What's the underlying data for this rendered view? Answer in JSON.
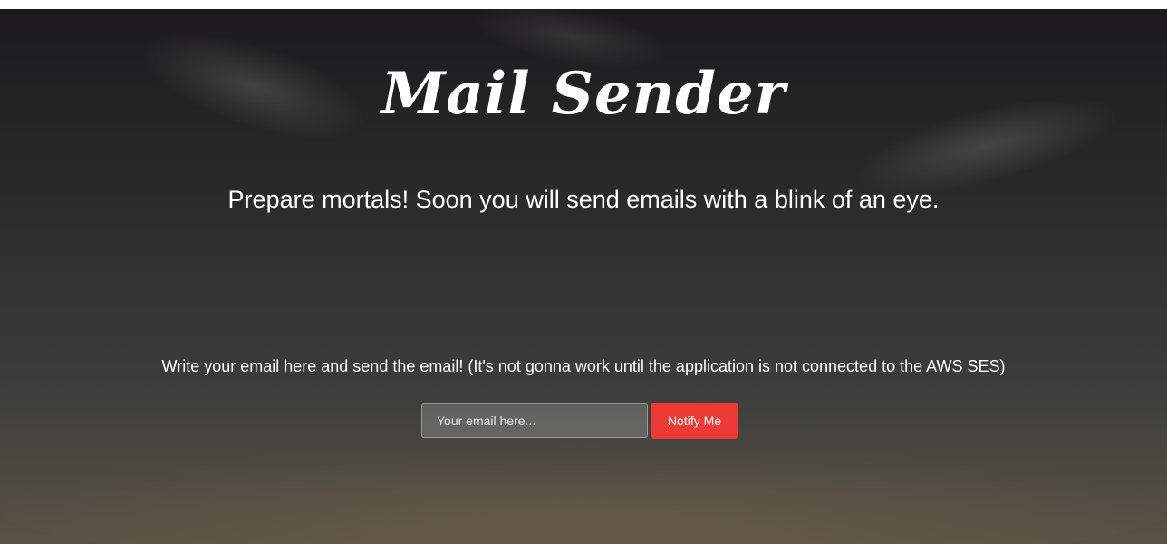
{
  "page": {
    "title": "Mail Sender",
    "tagline": "Prepare mortals! Soon you will send emails with a blink of an eye.",
    "instruction": "Write your email here and send the email! (It's not gonna work until the application is not connected to the AWS SES)"
  },
  "form": {
    "email_placeholder": "Your email here...",
    "email_value": "",
    "submit_label": "Notify Me"
  },
  "colors": {
    "button": "#ee3a36",
    "text": "#ffffff",
    "background": "#2a2d2c"
  }
}
